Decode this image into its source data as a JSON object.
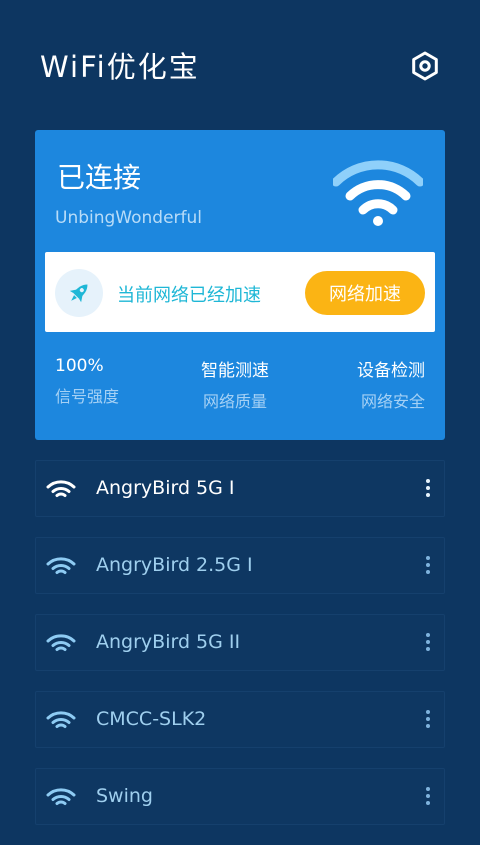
{
  "header": {
    "title": "WiFi优化宝",
    "settings_icon": "settings-hexagon-icon"
  },
  "card": {
    "status": "已连接",
    "ssid": "UnbingWonderful",
    "wifi_icon": "wifi-large-icon",
    "boost": {
      "icon": "rocket-icon",
      "text": "当前网络已经加速",
      "button_label": "网络加速"
    },
    "stats": [
      {
        "value": "100%",
        "label": "信号强度"
      },
      {
        "value": "智能测速",
        "label": "网络质量"
      },
      {
        "value": "设备检测",
        "label": "网络安全"
      }
    ]
  },
  "networks": [
    {
      "name": "AngryBird 5G I",
      "active": true
    },
    {
      "name": "AngryBird 2.5G I",
      "active": false
    },
    {
      "name": "AngryBird 5G II",
      "active": false
    },
    {
      "name": "CMCC-SLK2",
      "active": false
    },
    {
      "name": "Swing",
      "active": false
    }
  ],
  "colors": {
    "background": "#0d3661",
    "card": "#1d87de",
    "accent_orange": "#fbb414",
    "accent_teal": "#1fb7d6"
  }
}
